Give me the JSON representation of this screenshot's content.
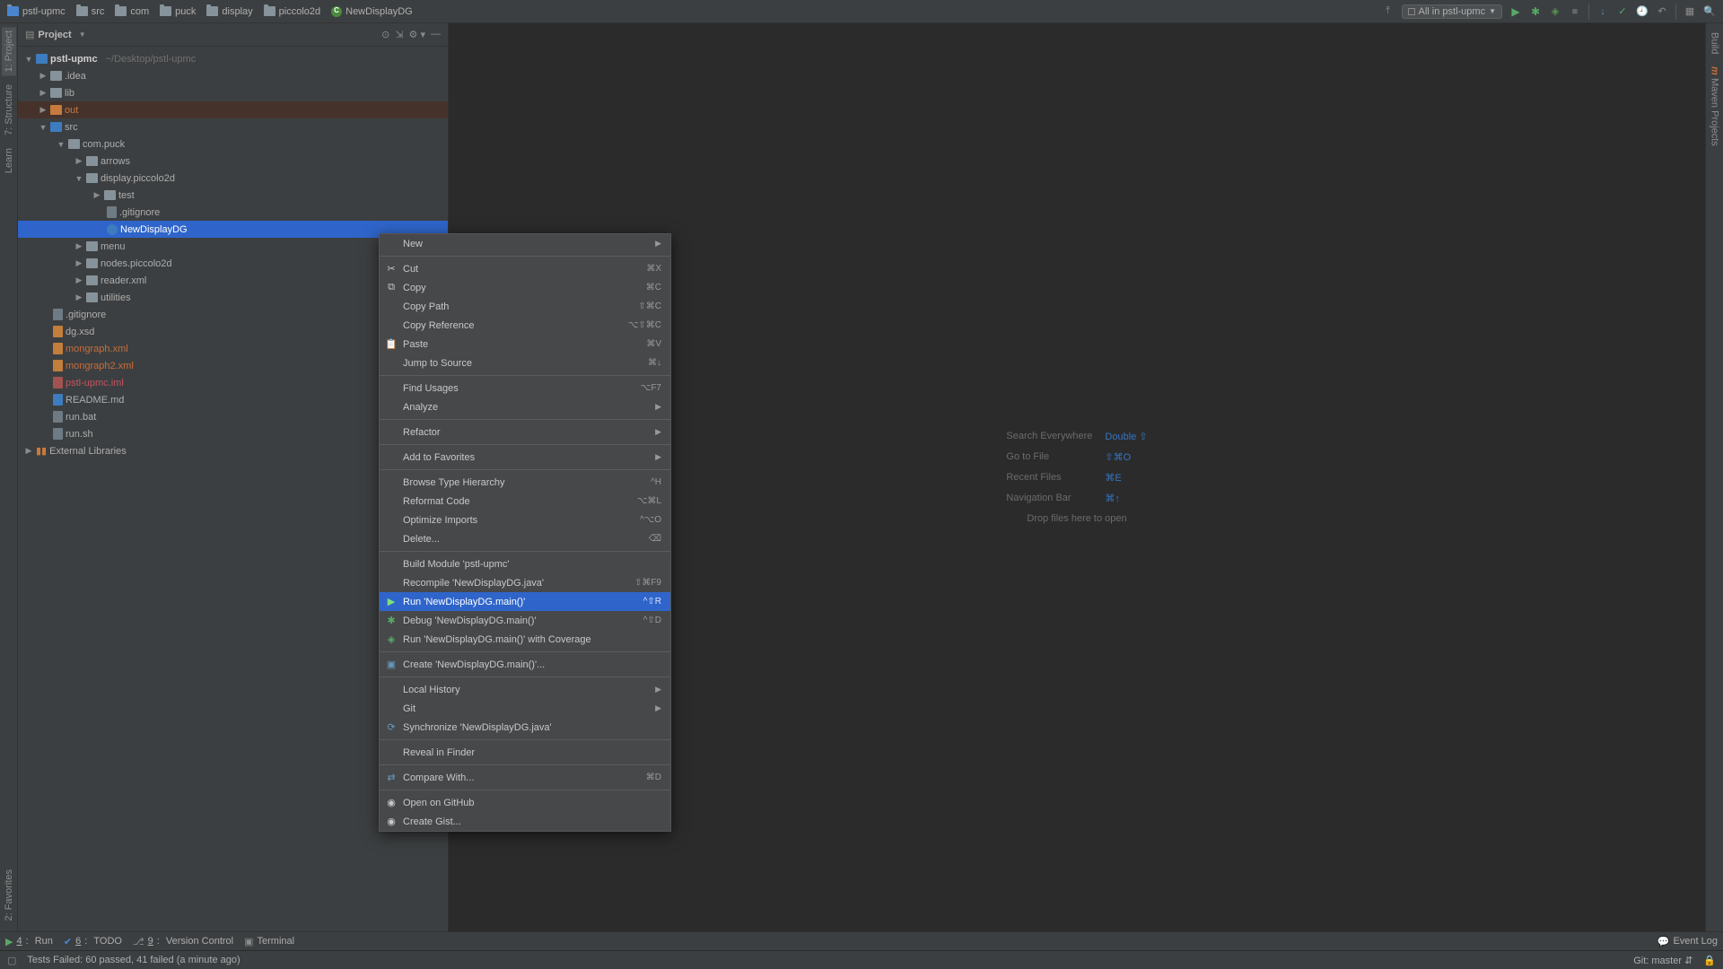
{
  "breadcrumbs": {
    "root": "pstl-upmc",
    "items": [
      "src",
      "com",
      "puck",
      "display",
      "piccolo2d",
      "NewDisplayDG"
    ]
  },
  "run_config": {
    "label": "All in pstl-upmc"
  },
  "project_header": {
    "title": "Project"
  },
  "tree": {
    "root": {
      "name": "pstl-upmc",
      "path": "~/Desktop/pstl-upmc"
    },
    "idea": ".idea",
    "lib": "lib",
    "out": "out",
    "src": "src",
    "compuck": "com.puck",
    "arrows": "arrows",
    "displaypiccolo": "display.piccolo2d",
    "test": "test",
    "gitignore_pkg": ".gitignore",
    "newdisplay": "NewDisplayDG",
    "menu": "menu",
    "nodespiccolo": "nodes.piccolo2d",
    "readerxml": "reader.xml",
    "utilities": "utilities",
    "gitignore": ".gitignore",
    "dgxsd": "dg.xsd",
    "mongraph": "mongraph.xml",
    "mongraph2": "mongraph2.xml",
    "iml": "pstl-upmc.iml",
    "readme": "README.md",
    "runbat": "run.bat",
    "runsh": "run.sh",
    "extlib": "External Libraries"
  },
  "placeholder": {
    "l1": "Search Everywhere",
    "s1": "Double ⇧",
    "l2": "Go to File",
    "s2": "⇧⌘O",
    "l3": "Recent Files",
    "s3": "⌘E",
    "l4": "Navigation Bar",
    "s4": "⌘↑",
    "l5": "Drop files here to open"
  },
  "context_menu": {
    "new": "New",
    "cut": "Cut",
    "cut_s": "⌘X",
    "copy": "Copy",
    "copy_s": "⌘C",
    "copy_path": "Copy Path",
    "copy_path_s": "⇧⌘C",
    "copy_ref": "Copy Reference",
    "copy_ref_s": "⌥⇧⌘C",
    "paste": "Paste",
    "paste_s": "⌘V",
    "jump": "Jump to Source",
    "jump_s": "⌘↓",
    "find": "Find Usages",
    "find_s": "⌥F7",
    "analyze": "Analyze",
    "refactor": "Refactor",
    "fav": "Add to Favorites",
    "browse": "Browse Type Hierarchy",
    "browse_s": "^H",
    "reformat": "Reformat Code",
    "reformat_s": "⌥⌘L",
    "optimize": "Optimize Imports",
    "optimize_s": "^⌥O",
    "delete": "Delete...",
    "delete_s": "⌫",
    "build": "Build Module 'pstl-upmc'",
    "recompile": "Recompile 'NewDisplayDG.java'",
    "recompile_s": "⇧⌘F9",
    "run": "Run 'NewDisplayDG.main()'",
    "run_s": "^⇧R",
    "debug": "Debug 'NewDisplayDG.main()'",
    "debug_s": "^⇧D",
    "coverage": "Run 'NewDisplayDG.main()' with Coverage",
    "create": "Create 'NewDisplayDG.main()'...",
    "local_hist": "Local History",
    "git": "Git",
    "sync": "Synchronize 'NewDisplayDG.java'",
    "reveal": "Reveal in Finder",
    "compare": "Compare With...",
    "compare_s": "⌘D",
    "github": "Open on GitHub",
    "gist": "Create Gist..."
  },
  "bottom_tabs": {
    "run": "Run",
    "run_n": "4",
    "todo": "TODO",
    "todo_n": "6",
    "vc": "Version Control",
    "vc_n": "9",
    "terminal": "Terminal"
  },
  "bottom_right": {
    "eventlog": "Event Log"
  },
  "status": {
    "text": "Tests Failed: 60 passed, 41 failed (a minute ago)",
    "git": "Git: master"
  },
  "gutter": {
    "project": "1: Project",
    "structure": "7: Structure",
    "learn": "Learn",
    "favorites": "2: Favorites",
    "build": "Build",
    "maven": "Maven Projects"
  }
}
